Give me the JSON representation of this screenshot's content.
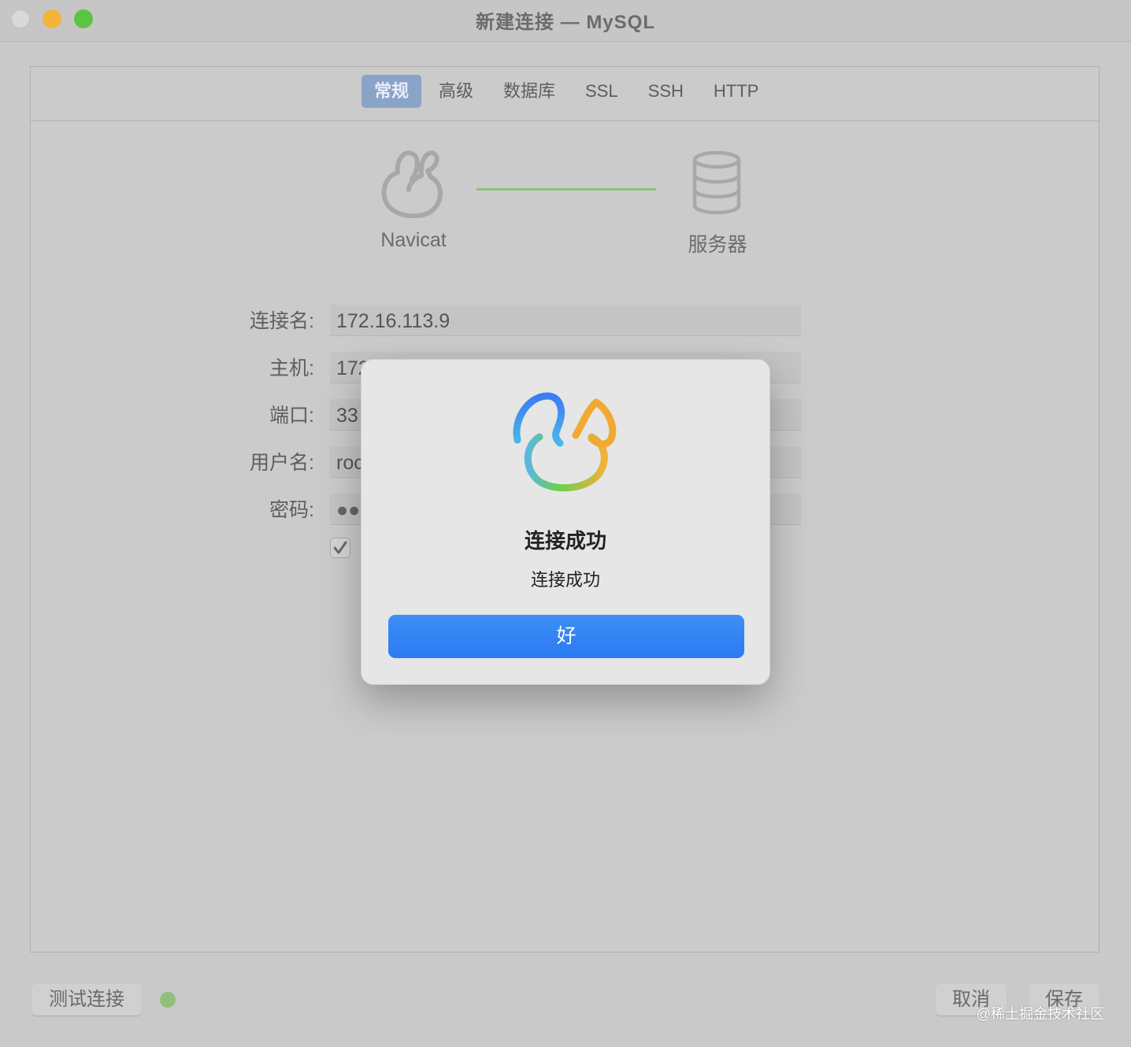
{
  "window": {
    "title": "新建连接 — MySQL",
    "controls": [
      "close",
      "minimize",
      "zoom"
    ]
  },
  "tabs": [
    {
      "label": "常规",
      "active": true
    },
    {
      "label": "高级",
      "active": false
    },
    {
      "label": "数据库",
      "active": false
    },
    {
      "label": "SSL",
      "active": false
    },
    {
      "label": "SSH",
      "active": false
    },
    {
      "label": "HTTP",
      "active": false
    }
  ],
  "connection_graphic": {
    "left_label": "Navicat",
    "right_label": "服务器",
    "left_icon": "navicat-logo-icon",
    "right_icon": "database-icon",
    "link_color": "#8ec07a"
  },
  "form": {
    "connection_name": {
      "label": "连接名:",
      "value": "172.16.113.9"
    },
    "host": {
      "label": "主机:",
      "value": "172"
    },
    "port": {
      "label": "端口:",
      "value": "33"
    },
    "username": {
      "label": "用户名:",
      "value": "roc"
    },
    "password": {
      "label": "密码:",
      "value": "●●"
    },
    "save_password_checked": true
  },
  "footer": {
    "test_button": "测试连接",
    "status_color": "#8ec07a",
    "cancel_button": "取消",
    "save_button": "保存",
    "watermark": "@稀土掘金技术社区"
  },
  "dialog": {
    "title": "连接成功",
    "message": "连接成功",
    "ok_button": "好",
    "icon": "navicat-logo-icon",
    "accent_color": "#2f80f4"
  }
}
